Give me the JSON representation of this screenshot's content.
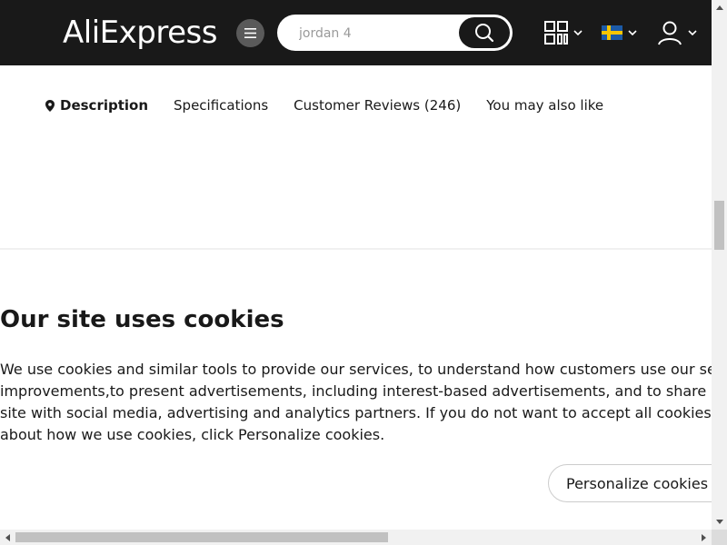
{
  "header": {
    "logo_text": "AliExpress",
    "search": {
      "placeholder": "jordan 4"
    },
    "icons": [
      "menu-icon",
      "search-icon",
      "qr-code-icon",
      "sweden-flag-icon",
      "user-icon",
      "chevron-down-icon"
    ]
  },
  "tabs": [
    {
      "label": "Description",
      "active": true
    },
    {
      "label": "Specifications",
      "active": false
    },
    {
      "label": "Customer Reviews (246)",
      "active": false
    },
    {
      "label": "You may also like",
      "active": false
    }
  ],
  "cookie_banner": {
    "title": "Our site uses cookies",
    "lines": [
      "We use cookies and similar tools to provide our services, to understand how customers use our service so",
      "improvements,to present advertisements, including interest-based advertisements, and to share informa",
      "site with social media, advertising and analytics partners. If you do not want to accept all cookies, or if you",
      "about how we use cookies, click Personalize cookies."
    ],
    "personalize_label": "Personalize cookies"
  },
  "colors": {
    "header_bg": "#191919",
    "text": "#191919",
    "menu_btn": "#5a5a5a",
    "scrollbar_thumb": "#c1c1c1"
  }
}
